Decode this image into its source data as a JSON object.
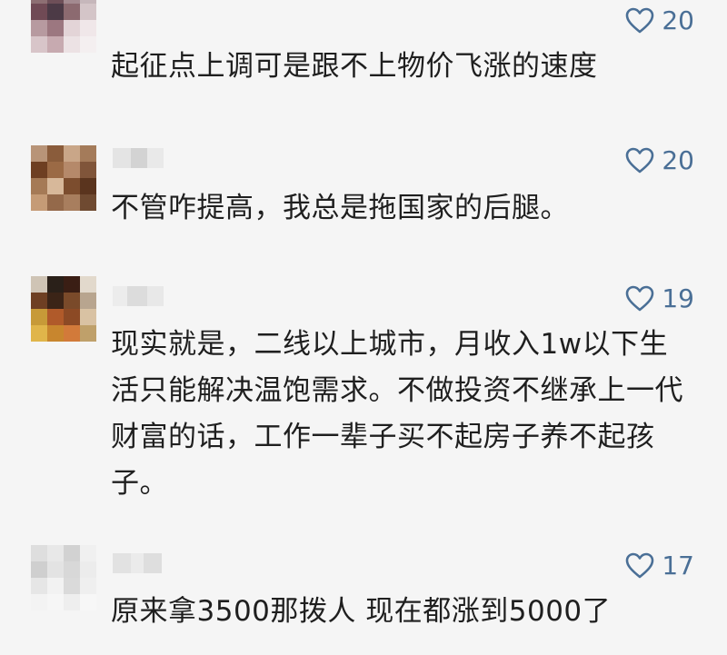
{
  "comments": [
    {
      "likes": "20",
      "text": "起征点上调可是跟不上物价飞涨的速度",
      "avatar_colors": [
        "#8d6f73",
        "#6e4f58",
        "#a38a90",
        "#c6b7bb",
        "#704a55",
        "#4c3a46",
        "#8c6a70",
        "#d4c5c8",
        "#b79aa0",
        "#9c7780",
        "#e3d4d7",
        "#f0e7e9",
        "#d8c5c9",
        "#c7aab0",
        "#ece2e4",
        "#f4eff0"
      ]
    },
    {
      "likes": "20",
      "text": "不管咋提高，我总是拖国家的后腿。",
      "avatar_colors": [
        "#b89478",
        "#8a5c3b",
        "#c9a688",
        "#a47b5a",
        "#6e3f22",
        "#9b6a45",
        "#b5896a",
        "#80553a",
        "#a57a56",
        "#d7b89a",
        "#7c4d2e",
        "#5a341e",
        "#c59b76",
        "#94694a",
        "#a87e5e",
        "#6f4a31"
      ]
    },
    {
      "likes": "19",
      "text": "现实就是，二线以上城市，月收入1w以下生活只能解决温饱需求。不做投资不继承上一代财富的话，工作一辈子买不起房子养不起孩子。",
      "avatar_colors": [
        "#cfc4b5",
        "#2a2019",
        "#3a1e14",
        "#e2d9cc",
        "#6e3f23",
        "#3b2417",
        "#7a4a2a",
        "#b8a58f",
        "#c79a38",
        "#b05a2a",
        "#8c4a25",
        "#d9c2a3",
        "#e0b54a",
        "#c8862e",
        "#d27a3a",
        "#bfa06a"
      ]
    },
    {
      "likes": "17",
      "text": "原来拿3500那拨人 现在都涨到5000了",
      "avatar_colors": [
        "#dedede",
        "#e8e8e8",
        "#d2d2d2",
        "#f0f0f0",
        "#cfcfcf",
        "#e3e3e3",
        "#d8d8d8",
        "#ececec",
        "#e6e6e6",
        "#f2f2f2",
        "#dadada",
        "#efefef",
        "#f3f3f3",
        "#f6f6f6",
        "#eeeeee",
        "#f7f7f7"
      ]
    }
  ],
  "colors": {
    "background": "#f5f5f5",
    "text": "#1f1f1f",
    "accent": "#4a6f96"
  },
  "icons": {
    "like": "heart-outline-icon"
  }
}
